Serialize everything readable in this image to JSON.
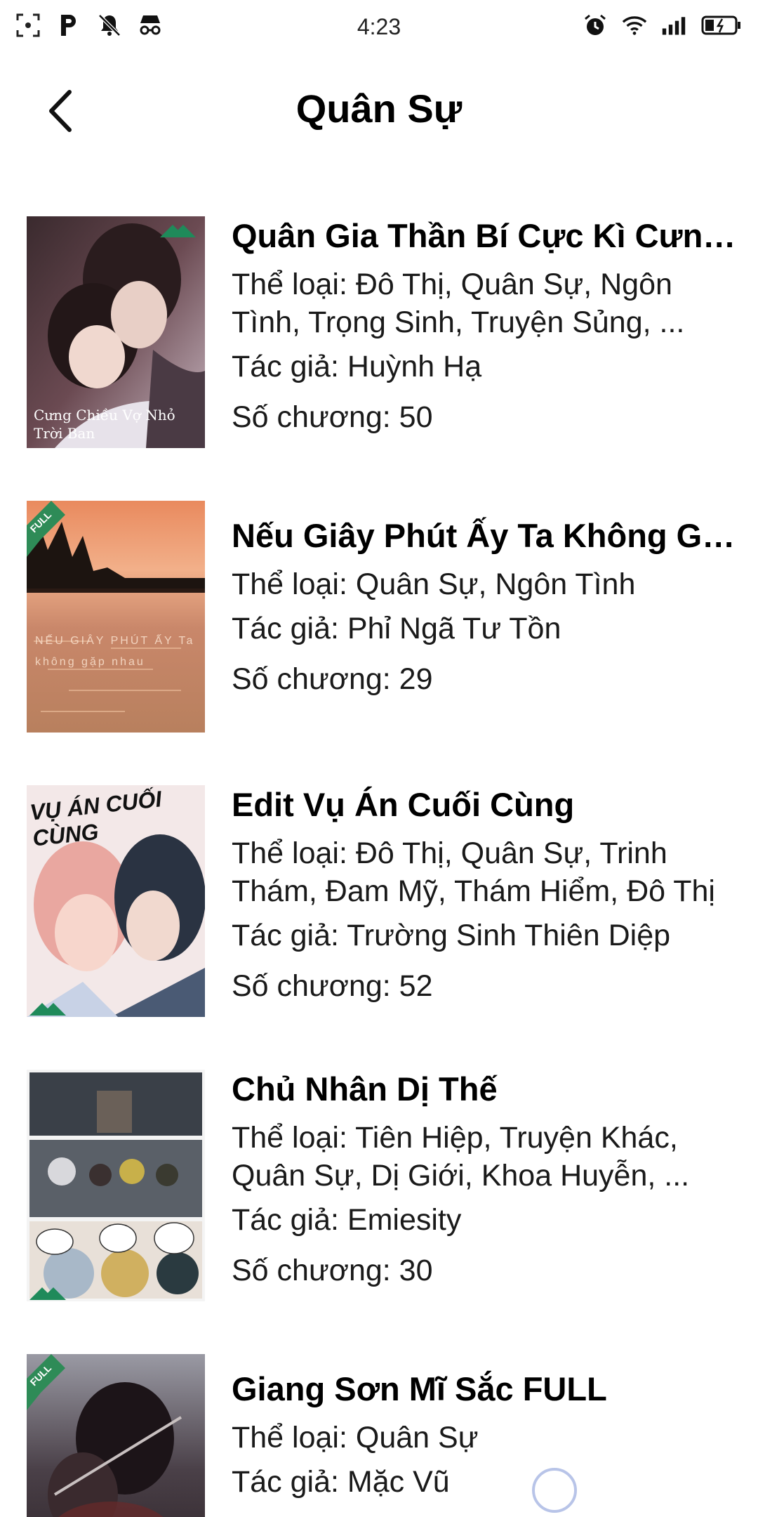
{
  "status_bar": {
    "time": "4:23",
    "left_icons": [
      "screenshot-icon",
      "parking-icon",
      "bell-off-icon",
      "incognito-icon"
    ],
    "right_icons": [
      "alarm-icon",
      "wifi-icon",
      "signal-icon",
      "battery-icon"
    ]
  },
  "header": {
    "title": "Quân Sự"
  },
  "labels": {
    "genre": "Thể loại: ",
    "author": "Tác giả: ",
    "chapters": "Số chương: "
  },
  "stories": [
    {
      "title": "Quân Gia Thần Bí Cực Kì Cưng ...",
      "genre": "Thể loại:  Đô Thị, Quân Sự, Ngôn Tình, Trọng Sinh, Truyện Sủng, ...",
      "author": "Tác giả: Huỳnh Hạ",
      "chapters": "Số chương: 50",
      "cover_caption": "Cưng Chiều Vợ Nhỏ Trời Ban",
      "badge": "wm"
    },
    {
      "title": "Nếu Giây Phút Ấy Ta Không Gặ...",
      "genre": "Thể loại:  Quân Sự, Ngôn Tình",
      "author": "Tác giả: Phỉ Ngã Tư Tồn",
      "chapters": "Số chương: 29",
      "cover_caption": "NẾU GIÂY PHÚT ẤY Ta không gặp nhau",
      "badge": "FULL"
    },
    {
      "title": "Edit Vụ Án Cuối Cùng",
      "genre": "Thể loại:  Đô Thị, Quân Sự, Trinh Thám, Đam Mỹ, Thám Hiểm, Đô Thị",
      "author": "Tác giả: Trường Sinh Thiên Diệp",
      "chapters": "Số chương: 52",
      "cover_caption": "VỤ ÁN CUỐI CÙNG",
      "badge": "wm"
    },
    {
      "title": "Chủ Nhân Dị Thế",
      "genre": "Thể loại:  Tiên Hiệp, Truyện Khác, Quân Sự, Dị Giới, Khoa Huyễn, ...",
      "author": "Tác giả: Emiesity",
      "chapters": "Số chương: 30",
      "cover_caption": "",
      "badge": "wm"
    },
    {
      "title": "Giang Sơn Mĩ Sắc FULL",
      "genre": "Thể loại:  Quân Sự",
      "author": "Tác giả: Mặc Vũ",
      "chapters": "",
      "cover_caption": "",
      "badge": "FULL"
    }
  ],
  "colors": {
    "badge_green": "#2e8b57",
    "spinner": "#b8c4e8"
  }
}
